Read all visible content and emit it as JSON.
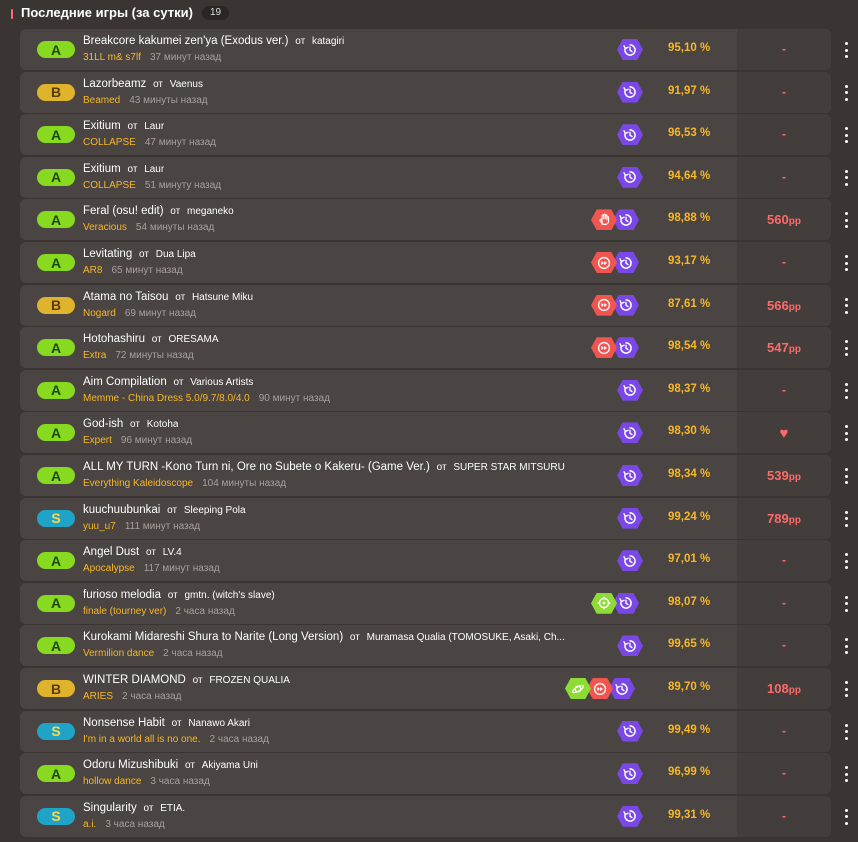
{
  "header": {
    "title": "Последние игры (за сутки)",
    "count": "19"
  },
  "colors": {
    "grade_A": "#88da20",
    "grade_B": "#e0b32c",
    "grade_S": "#1fa4c8",
    "accuracy": "#f7b827",
    "pp": "#ff6a6a",
    "difficulty": "#f7b827",
    "mod_purple": "#7a48e6",
    "mod_red": "#f0554f",
    "mod_green": "#8ddc35"
  },
  "rows": [
    {
      "grade": "A",
      "title": "Breakcore kakumei zen'ya (Exodus ver.)",
      "by": "от",
      "artist": "katagiri",
      "difficulty": "31LL m& s7lf",
      "ago": "37 минут назад",
      "mods": [
        "replay-icon"
      ],
      "accuracy": "95,10 %",
      "pp": "-",
      "pp_unit": ""
    },
    {
      "grade": "B",
      "title": "Lazorbeamz",
      "by": "от",
      "artist": "Vaenus",
      "difficulty": "Beamed",
      "ago": "43 минуты назад",
      "mods": [
        "replay-icon"
      ],
      "accuracy": "91,97 %",
      "pp": "-",
      "pp_unit": ""
    },
    {
      "grade": "A",
      "title": "Exitium",
      "by": "от",
      "artist": "Laur",
      "difficulty": "COLLAPSE",
      "ago": "47 минут назад",
      "mods": [
        "replay-icon"
      ],
      "accuracy": "96,53 %",
      "pp": "-",
      "pp_unit": ""
    },
    {
      "grade": "A",
      "title": "Exitium",
      "by": "от",
      "artist": "Laur",
      "difficulty": "COLLAPSE",
      "ago": "51 минуту назад",
      "mods": [
        "replay-icon"
      ],
      "accuracy": "94,64 %",
      "pp": "-",
      "pp_unit": ""
    },
    {
      "grade": "A",
      "title": "Feral (osu! edit)",
      "by": "от",
      "artist": "meganeko",
      "difficulty": "Veracious",
      "ago": "54 минуты назад",
      "mods": [
        "replay-icon",
        "hand-icon"
      ],
      "accuracy": "98,88 %",
      "pp": "560",
      "pp_unit": "pp"
    },
    {
      "grade": "A",
      "title": "Levitating",
      "by": "от",
      "artist": "Dua Lipa",
      "difficulty": "AR8",
      "ago": "65 минут назад",
      "mods": [
        "replay-icon",
        "fast-forward-icon"
      ],
      "accuracy": "93,17 %",
      "pp": "-",
      "pp_unit": ""
    },
    {
      "grade": "B",
      "title": "Atama no Taisou",
      "by": "от",
      "artist": "Hatsune Miku",
      "difficulty": "Nogard",
      "ago": "69 минут назад",
      "mods": [
        "replay-icon",
        "fast-forward-icon"
      ],
      "accuracy": "87,61 %",
      "pp": "566",
      "pp_unit": "pp"
    },
    {
      "grade": "A",
      "title": "Hotohashiru",
      "by": "от",
      "artist": "ORESAMA",
      "difficulty": "Extra",
      "ago": "72 минуты назад",
      "mods": [
        "replay-icon",
        "fast-forward-icon"
      ],
      "accuracy": "98,54 %",
      "pp": "547",
      "pp_unit": "pp"
    },
    {
      "grade": "A",
      "title": "Aim Compilation",
      "by": "от",
      "artist": "Various Artists",
      "difficulty": "Memme - China Dress 5.0/9.7/8.0/4.0",
      "ago": "90 минут назад",
      "mods": [
        "replay-icon"
      ],
      "accuracy": "98,37 %",
      "pp": "-",
      "pp_unit": ""
    },
    {
      "grade": "A",
      "title": "God-ish",
      "by": "от",
      "artist": "Kotoha",
      "difficulty": "Expert",
      "ago": "96 минут назад",
      "mods": [
        "replay-icon"
      ],
      "accuracy": "98,30 %",
      "pp": "♥",
      "pp_unit": ""
    },
    {
      "grade": "A",
      "title": "ALL MY TURN -Kono Turn ni, Ore no Subete o Kakeru- (Game Ver.)",
      "by": "от",
      "artist": "SUPER STAR MITSURU",
      "difficulty": "Everything Kaleidoscope",
      "ago": "104 минуты назад",
      "mods": [
        "replay-icon"
      ],
      "accuracy": "98,34 %",
      "pp": "539",
      "pp_unit": "pp"
    },
    {
      "grade": "S",
      "title": "kuuchuubunkai",
      "by": "от",
      "artist": "Sleeping Pola",
      "difficulty": "yuu_u7",
      "ago": "111 минут назад",
      "mods": [
        "replay-icon"
      ],
      "accuracy": "99,24 %",
      "pp": "789",
      "pp_unit": "pp"
    },
    {
      "grade": "A",
      "title": "Angel Dust",
      "by": "от",
      "artist": "LV.4",
      "difficulty": "Apocalypse",
      "ago": "117 минут назад",
      "mods": [
        "replay-icon"
      ],
      "accuracy": "97,01 %",
      "pp": "-",
      "pp_unit": ""
    },
    {
      "grade": "A",
      "title": "furioso melodia",
      "by": "от",
      "artist": "gmtn. (witch's slave)",
      "difficulty": "finale (tourney ver)",
      "ago": "2 часа назад",
      "mods": [
        "replay-icon",
        "target-icon"
      ],
      "accuracy": "98,07 %",
      "pp": "-",
      "pp_unit": ""
    },
    {
      "grade": "A",
      "title": "Kurokami Midareshi Shura to Narite (Long Version)",
      "by": "от",
      "artist": "Muramasa Qualia (TOMOSUKE, Asaki, Ch...",
      "difficulty": "Vermilion dance",
      "ago": "2 часа назад",
      "mods": [
        "replay-icon"
      ],
      "accuracy": "99,65 %",
      "pp": "-",
      "pp_unit": ""
    },
    {
      "grade": "B",
      "title": "WINTER DIAMOND",
      "by": "от",
      "artist": "FROZEN QUALIA",
      "difficulty": "ARIES",
      "ago": "2 часа назад",
      "mods": [
        "replay-icon",
        "fast-forward-icon",
        "saturn-icon"
      ],
      "accuracy": "89,70 %",
      "pp": "108",
      "pp_unit": "pp"
    },
    {
      "grade": "S",
      "title": "Nonsense Habit",
      "by": "от",
      "artist": "Nanawo Akari",
      "difficulty": "I'm in a world all is no one.",
      "ago": "2 часа назад",
      "mods": [
        "replay-icon"
      ],
      "accuracy": "99,49 %",
      "pp": "-",
      "pp_unit": ""
    },
    {
      "grade": "A",
      "title": "Odoru Mizushibuki",
      "by": "от",
      "artist": "Akiyama Uni",
      "difficulty": "hollow dance",
      "ago": "3 часа назад",
      "mods": [
        "replay-icon"
      ],
      "accuracy": "96,99 %",
      "pp": "-",
      "pp_unit": ""
    },
    {
      "grade": "S",
      "title": "Singularity",
      "by": "от",
      "artist": "ETIA.",
      "difficulty": "a.i.",
      "ago": "3 часа назад",
      "mods": [
        "replay-icon"
      ],
      "accuracy": "99,31 %",
      "pp": "-",
      "pp_unit": ""
    }
  ]
}
